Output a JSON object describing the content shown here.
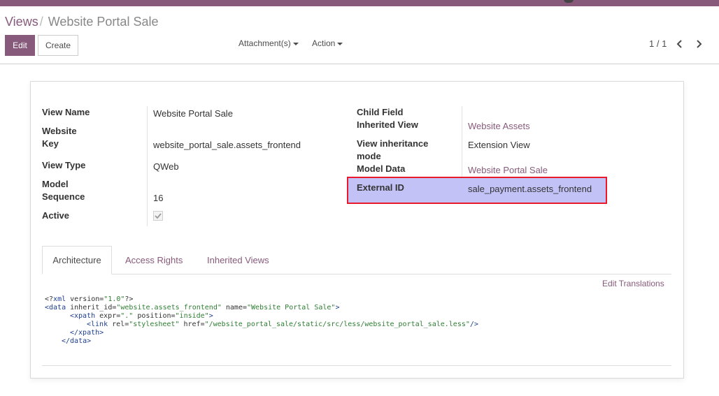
{
  "breadcrumb": {
    "parent": "Views",
    "separator": "/",
    "current": "Website Portal Sale"
  },
  "buttons": {
    "edit": "Edit",
    "create": "Create"
  },
  "dropdowns": {
    "attachments": "Attachment(s)",
    "action": "Action"
  },
  "pager": {
    "value": "1 / 1"
  },
  "form": {
    "view_name_label": "View Name",
    "view_name": "Website Portal Sale",
    "website_label": "Website",
    "key_label": "Key",
    "key": "website_portal_sale.assets_frontend",
    "view_type_label": "View Type",
    "view_type": "QWeb",
    "model_label": "Model",
    "sequence_label": "Sequence",
    "sequence": "16",
    "active_label": "Active",
    "active": true,
    "child_field_label": "Child Field",
    "inherited_view_label": "Inherited View",
    "inherited_view": "Website Assets",
    "inheritance_mode_label_1": "View inheritance",
    "inheritance_mode_label_2": "mode",
    "inheritance_mode": "Extension View",
    "model_data_label": "Model Data",
    "model_data": "Website Portal Sale",
    "external_id_label": "External ID",
    "external_id": "sale_payment.assets_frontend"
  },
  "tabs": [
    "Architecture",
    "Access Rights",
    "Inherited Views"
  ],
  "edit_translations": "Edit Translations",
  "code": {
    "l1": {
      "a": "<?",
      "b": "xml",
      "c": " version=",
      "d": "\"1.0\"",
      "e": "?>"
    },
    "l2": {
      "a": "<data",
      "b": " inherit_id=",
      "c": "\"website.assets_frontend\"",
      "d": " name=",
      "e": "\"Website Portal Sale\"",
      "f": ">"
    },
    "l3": {
      "a": "<xpath",
      "b": " expr=",
      "c": "\".\"",
      "d": " position=",
      "e": "\"inside\"",
      "f": ">"
    },
    "l4": {
      "a": "<link",
      "b": " rel=",
      "c": "\"stylesheet\"",
      "d": " href=",
      "e": "\"/website_portal_sale/static/src/less/website_portal_sale.less\"",
      "f": "/>"
    },
    "l5": "</xpath>",
    "l6": "</data>"
  },
  "colors": {
    "brand": "#875a7b",
    "highlight_fill": "#c2c2f7",
    "highlight_border": "#e8192c"
  }
}
